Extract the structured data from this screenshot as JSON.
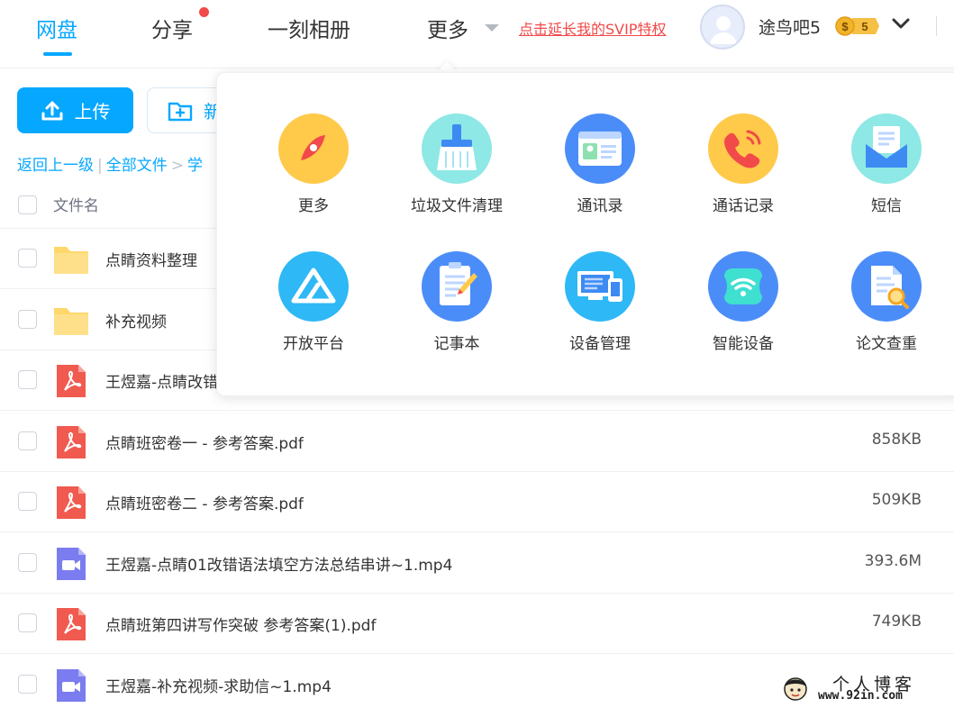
{
  "nav": {
    "items": [
      "网盘",
      "分享",
      "一刻相册",
      "更多"
    ],
    "active": "网盘",
    "svip_link": "点击延长我的SVIP特权",
    "username": "途鸟吧5",
    "vip_level": "5"
  },
  "toolbar": {
    "upload_label": "上传",
    "new_label": "新"
  },
  "breadcrumb": {
    "back": "返回上一级",
    "all_files": "全部文件",
    "current": "学"
  },
  "table": {
    "header_name": "文件名",
    "rows": [
      {
        "type": "folder",
        "name": "点睛资料整理",
        "size": ""
      },
      {
        "type": "folder",
        "name": "补充视频",
        "size": ""
      },
      {
        "type": "pdf",
        "name": "王煜嘉-点睛改错",
        "size": ""
      },
      {
        "type": "pdf",
        "name": "点睛班密卷一 - 参考答案.pdf",
        "size": "858KB"
      },
      {
        "type": "pdf",
        "name": "点睛班密卷二 - 参考答案.pdf",
        "size": "509KB"
      },
      {
        "type": "video",
        "name": "王煜嘉-点睛01改错语法填空方法总结串讲~1.mp4",
        "size": "393.6M"
      },
      {
        "type": "pdf",
        "name": "点睛班第四讲写作突破 参考答案(1).pdf",
        "size": "749KB"
      },
      {
        "type": "video",
        "name": "王煜嘉-补充视频-求助信~1.mp4",
        "size": ""
      }
    ]
  },
  "more_panel": {
    "tools": [
      {
        "label": "更多",
        "icon": "compass-icon"
      },
      {
        "label": "垃圾文件清理",
        "icon": "broom-icon"
      },
      {
        "label": "通讯录",
        "icon": "contact-card-icon"
      },
      {
        "label": "通话记录",
        "icon": "phone-icon"
      },
      {
        "label": "短信",
        "icon": "envelope-icon"
      },
      {
        "label": "开放平台",
        "icon": "open-platform-icon"
      },
      {
        "label": "记事本",
        "icon": "notepad-icon"
      },
      {
        "label": "设备管理",
        "icon": "devices-icon"
      },
      {
        "label": "智能设备",
        "icon": "wifi-icon"
      },
      {
        "label": "论文查重",
        "icon": "document-search-icon"
      }
    ]
  },
  "watermark": {
    "title": "个人博客",
    "url": "www.92in.com"
  },
  "colors": {
    "accent": "#06a7ff",
    "alert": "#f2494a",
    "folder": "#ffd76b",
    "pdf": "#f05a4f",
    "video": "#7a7cf0"
  }
}
